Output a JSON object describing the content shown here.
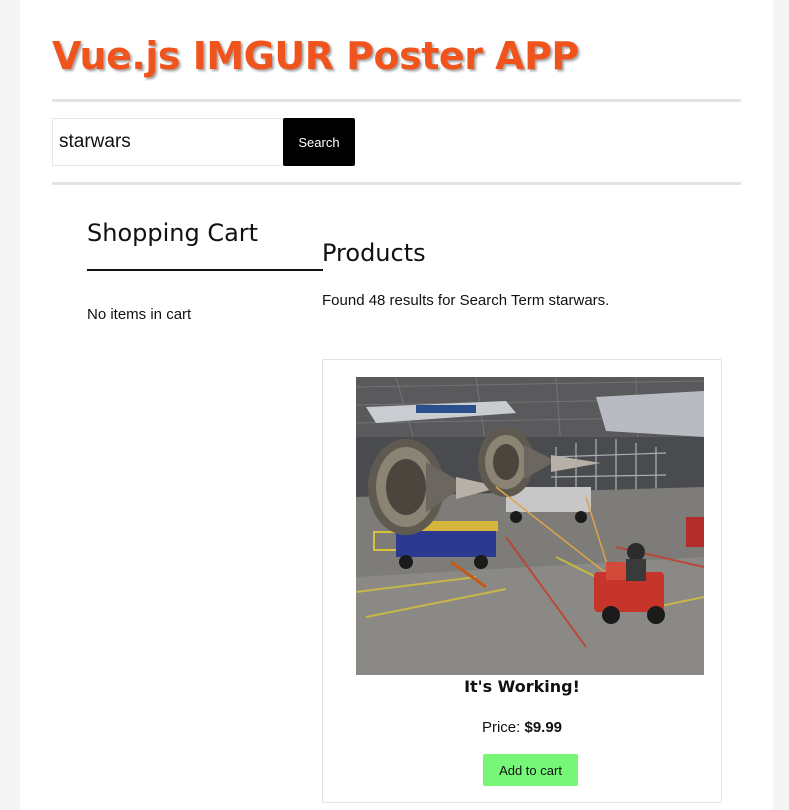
{
  "app": {
    "title": "Vue.js IMGUR Poster APP"
  },
  "search": {
    "value": "starwars",
    "button_label": "Search"
  },
  "cart": {
    "title": "Shopping Cart",
    "empty_text": "No items in cart"
  },
  "products": {
    "title": "Products",
    "results_text": "Found 48 results for Search Term starwars.",
    "items": [
      {
        "name": "It's Working!",
        "price_label": "Price: ",
        "price": "$9.99",
        "add_button_label": "Add to cart",
        "image": "photo of jet engines on carts being towed by a tug in an aircraft hangar"
      }
    ]
  },
  "colors": {
    "title": "#f0541c",
    "search_button": "#000000",
    "add_button": "#77f777"
  }
}
